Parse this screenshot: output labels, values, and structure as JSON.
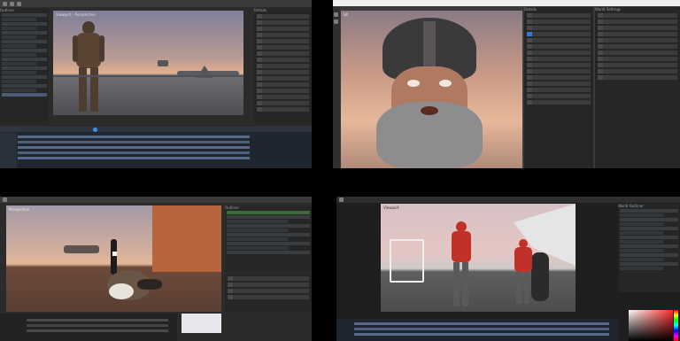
{
  "screens": [
    {
      "id": "q1",
      "viewport_label": "Viewport - Perspective",
      "outliner_label": "Outliner",
      "properties_label": "Details"
    },
    {
      "id": "q2",
      "viewport_label": "Lit",
      "panel_label": "Details",
      "panel2_label": "World Settings"
    },
    {
      "id": "q3",
      "viewport_label": "Perspective",
      "outliner_label": "Outliner"
    },
    {
      "id": "q4",
      "viewport_label": "Viewport",
      "outliner_label": "World Outliner"
    }
  ],
  "colors": {
    "editor_bg": "#2b2b2b",
    "panel_bg": "#262626",
    "accent": "#2f7fd0",
    "sky_warm": "#e7b89a",
    "sky_cool": "#8f93a8"
  },
  "icons": [
    "menu-icon",
    "play-icon",
    "camera-icon",
    "settings-icon",
    "color-picker-icon"
  ]
}
